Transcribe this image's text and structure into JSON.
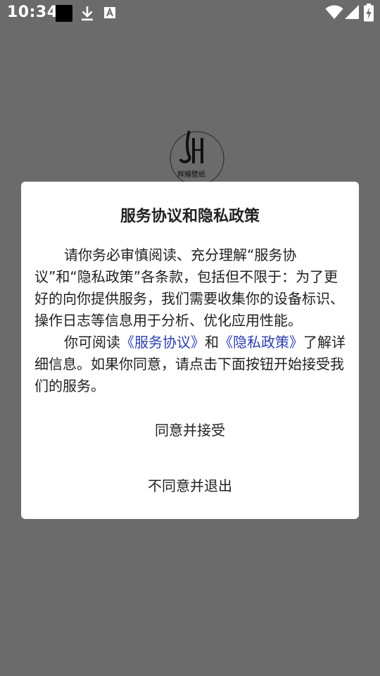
{
  "status_bar": {
    "time": "10:34",
    "left_icons": [
      "black-square-icon",
      "download-icon",
      "font-a-icon"
    ],
    "right_icons": [
      "wifi-icon",
      "signal-icon",
      "battery-charging-icon"
    ]
  },
  "background": {
    "logo_text": "辉耀壁纸",
    "overlay_color": "#6b6b6b"
  },
  "dialog": {
    "title": "服务协议和隐私政策",
    "paragraph1": "请你务必审慎阅读、充分理解“服务协议”和“隐私政策”各条款，包括但不限于：为了更好的向你提供服务，我们需要收集你的设备标识、操作日志等信息用于分析、优化应用性能。",
    "paragraph2": {
      "prefix": "你可阅读",
      "link1": "《服务协议》",
      "middle": "和",
      "link2": "《隐私政策》",
      "suffix": "了解详细信息。如果你同意，请点击下面按钮开始接受我们的服务。"
    },
    "agree_button": "同意并接受",
    "disagree_button": "不同意并退出"
  },
  "colors": {
    "link": "#2d3fb0",
    "dialog_bg": "#ffffff"
  }
}
